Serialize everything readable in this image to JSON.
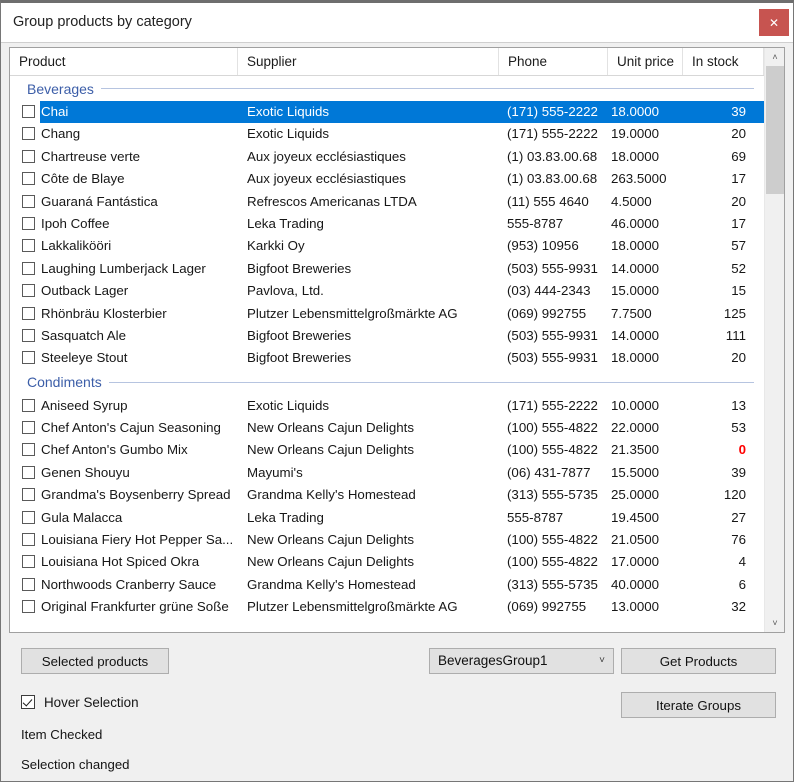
{
  "window": {
    "title": "Group products by category",
    "close_label": "✕",
    "close_icon": "close-icon"
  },
  "listview": {
    "columns": [
      {
        "key": "product",
        "label": "Product",
        "align": "left"
      },
      {
        "key": "supplier",
        "label": "Supplier",
        "align": "left"
      },
      {
        "key": "phone",
        "label": "Phone",
        "align": "left"
      },
      {
        "key": "price",
        "label": "Unit price",
        "align": "left"
      },
      {
        "key": "stock",
        "label": "In stock",
        "align": "right"
      }
    ],
    "selection_color": "#0078d7",
    "group_label_color": "#3c5ea8",
    "zero_stock_color": "#ff0000",
    "scrollbar": {
      "up_arrow": "˄",
      "down_arrow": "˅"
    },
    "groups": [
      {
        "name": "Beverages",
        "rows": [
          {
            "product": "Chai",
            "supplier": "Exotic Liquids",
            "phone": "(171) 555-2222",
            "price": "18.0000",
            "stock": "39",
            "checked": false,
            "selected": true
          },
          {
            "product": "Chang",
            "supplier": "Exotic Liquids",
            "phone": "(171) 555-2222",
            "price": "19.0000",
            "stock": "20",
            "checked": false,
            "selected": false
          },
          {
            "product": "Chartreuse verte",
            "supplier": "Aux joyeux ecclésiastiques",
            "phone": "(1) 03.83.00.68",
            "price": "18.0000",
            "stock": "69",
            "checked": false,
            "selected": false
          },
          {
            "product": "Côte de Blaye",
            "supplier": "Aux joyeux ecclésiastiques",
            "phone": "(1) 03.83.00.68",
            "price": "263.5000",
            "stock": "17",
            "checked": false,
            "selected": false
          },
          {
            "product": "Guaraná Fantástica",
            "supplier": "Refrescos Americanas LTDA",
            "phone": "(11) 555 4640",
            "price": "4.5000",
            "stock": "20",
            "checked": false,
            "selected": false
          },
          {
            "product": "Ipoh Coffee",
            "supplier": "Leka Trading",
            "phone": "555-8787",
            "price": "46.0000",
            "stock": "17",
            "checked": false,
            "selected": false
          },
          {
            "product": "Lakkalikööri",
            "supplier": "Karkki Oy",
            "phone": "(953) 10956",
            "price": "18.0000",
            "stock": "57",
            "checked": false,
            "selected": false
          },
          {
            "product": "Laughing Lumberjack Lager",
            "supplier": "Bigfoot Breweries",
            "phone": "(503) 555-9931",
            "price": "14.0000",
            "stock": "52",
            "checked": false,
            "selected": false
          },
          {
            "product": "Outback Lager",
            "supplier": "Pavlova, Ltd.",
            "phone": "(03) 444-2343",
            "price": "15.0000",
            "stock": "15",
            "checked": false,
            "selected": false
          },
          {
            "product": "Rhönbräu Klosterbier",
            "supplier": "Plutzer Lebensmittelgroßmärkte AG",
            "phone": "(069) 992755",
            "price": "7.7500",
            "stock": "125",
            "checked": false,
            "selected": false
          },
          {
            "product": "Sasquatch Ale",
            "supplier": "Bigfoot Breweries",
            "phone": "(503) 555-9931",
            "price": "14.0000",
            "stock": "111",
            "checked": false,
            "selected": false
          },
          {
            "product": "Steeleye Stout",
            "supplier": "Bigfoot Breweries",
            "phone": "(503) 555-9931",
            "price": "18.0000",
            "stock": "20",
            "checked": false,
            "selected": false
          }
        ]
      },
      {
        "name": "Condiments",
        "rows": [
          {
            "product": "Aniseed Syrup",
            "supplier": "Exotic Liquids",
            "phone": "(171) 555-2222",
            "price": "10.0000",
            "stock": "13",
            "checked": false,
            "selected": false
          },
          {
            "product": "Chef Anton's Cajun Seasoning",
            "supplier": "New Orleans Cajun Delights",
            "phone": "(100) 555-4822",
            "price": "22.0000",
            "stock": "53",
            "checked": false,
            "selected": false
          },
          {
            "product": "Chef Anton's Gumbo Mix",
            "supplier": "New Orleans Cajun Delights",
            "phone": "(100) 555-4822",
            "price": "21.3500",
            "stock": "0",
            "checked": false,
            "selected": false
          },
          {
            "product": "Genen Shouyu",
            "supplier": "Mayumi's",
            "phone": "(06) 431-7877",
            "price": "15.5000",
            "stock": "39",
            "checked": false,
            "selected": false
          },
          {
            "product": "Grandma's Boysenberry Spread",
            "supplier": "Grandma Kelly's Homestead",
            "phone": "(313) 555-5735",
            "price": "25.0000",
            "stock": "120",
            "checked": false,
            "selected": false
          },
          {
            "product": "Gula Malacca",
            "supplier": "Leka Trading",
            "phone": "555-8787",
            "price": "19.4500",
            "stock": "27",
            "checked": false,
            "selected": false
          },
          {
            "product": "Louisiana Fiery Hot Pepper Sa...",
            "supplier": "New Orleans Cajun Delights",
            "phone": "(100) 555-4822",
            "price": "21.0500",
            "stock": "76",
            "checked": false,
            "selected": false
          },
          {
            "product": "Louisiana Hot Spiced Okra",
            "supplier": "New Orleans Cajun Delights",
            "phone": "(100) 555-4822",
            "price": "17.0000",
            "stock": "4",
            "checked": false,
            "selected": false
          },
          {
            "product": "Northwoods Cranberry Sauce",
            "supplier": "Grandma Kelly's Homestead",
            "phone": "(313) 555-5735",
            "price": "40.0000",
            "stock": "6",
            "checked": false,
            "selected": false
          },
          {
            "product": "Original Frankfurter grüne Soße",
            "supplier": "Plutzer Lebensmittelgroßmärkte AG",
            "phone": "(069) 992755",
            "price": "13.0000",
            "stock": "32",
            "checked": false,
            "selected": false
          }
        ]
      }
    ]
  },
  "bottom": {
    "selected_products_label": "Selected products",
    "get_products_label": "Get Products",
    "iterate_groups_label": "Iterate Groups",
    "group_combo": {
      "value": "BeveragesGroup1",
      "arrow": "˅"
    },
    "hover_selection": {
      "label": "Hover Selection",
      "checked": true
    },
    "status_item_checked": "Item Checked",
    "status_selection_changed": "Selection changed"
  }
}
